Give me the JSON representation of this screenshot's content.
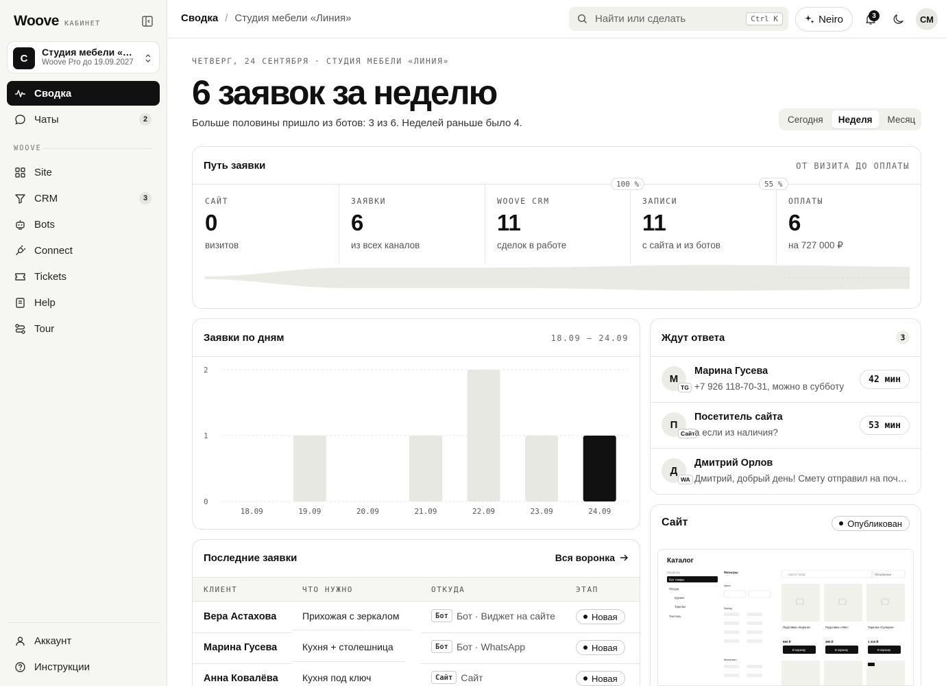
{
  "brand": {
    "name": "Woove",
    "sub": "КАБИНЕТ"
  },
  "workspace": {
    "initial": "С",
    "name": "Студия мебели «Линия»",
    "plan": "Woove Pro до 19.09.2027"
  },
  "nav": {
    "main": [
      {
        "label": "Сводка",
        "icon": "pulse-icon",
        "active": true
      },
      {
        "label": "Чаты",
        "icon": "chat-icon",
        "badge": "2"
      }
    ],
    "section": "WOOVE",
    "woove": [
      {
        "label": "Site",
        "icon": "grid-icon"
      },
      {
        "label": "CRM",
        "icon": "funnel-icon",
        "badge": "3"
      },
      {
        "label": "Bots",
        "icon": "bot-icon"
      },
      {
        "label": "Connect",
        "icon": "plug-icon"
      },
      {
        "label": "Tickets",
        "icon": "ticket-icon"
      },
      {
        "label": "Help",
        "icon": "book-icon"
      },
      {
        "label": "Tour",
        "icon": "route-icon"
      }
    ],
    "bottom": [
      {
        "label": "Аккаунт",
        "icon": "user-icon"
      },
      {
        "label": "Инструкции",
        "icon": "help-circle-icon"
      }
    ]
  },
  "topbar": {
    "crumb1": "Сводка",
    "crumb2": "Студия мебели «Линия»",
    "search_placeholder": "Найти или сделать",
    "shortcut": "Ctrl K",
    "neiro": "Neiro",
    "notifications": "3",
    "user_initials": "СМ"
  },
  "header": {
    "date_line": "ЧЕТВЕРГ, 24 СЕНТЯБРЯ · СТУДИЯ МЕБЕЛИ «ЛИНИЯ»",
    "headline": "6 заявок за неделю",
    "subline": "Больше половины пришло из ботов: 3 из 6. Неделей раньше было 4.",
    "periods": [
      "Сегодня",
      "Неделя",
      "Месяц"
    ],
    "active_period": "Неделя"
  },
  "funnel": {
    "title": "Путь заявки",
    "meta": "ОТ ВИЗИТА ДО ОПЛАТЫ",
    "stages": [
      {
        "label": "САЙТ",
        "value": "0",
        "sub": "визитов"
      },
      {
        "label": "ЗАЯВКИ",
        "value": "6",
        "sub": "из всех каналов"
      },
      {
        "label": "WOOVE CRM",
        "value": "11",
        "sub": "сделок в работе"
      },
      {
        "label": "ЗАПИСИ",
        "value": "11",
        "sub": "с сайта и из ботов"
      },
      {
        "label": "ОПЛАТЫ",
        "value": "6",
        "sub": "на 727 000 ₽"
      }
    ],
    "conversions": [
      "100 %",
      "55 %"
    ]
  },
  "daily": {
    "title": "Заявки по дням",
    "meta": "18.09 – 24.09"
  },
  "chart_data": {
    "type": "bar",
    "categories": [
      "18.09",
      "19.09",
      "20.09",
      "21.09",
      "22.09",
      "23.09",
      "24.09"
    ],
    "values": [
      0,
      1,
      0,
      1,
      2,
      1,
      1
    ],
    "highlight_index": 6,
    "ylim": [
      0,
      2
    ],
    "yticks": [
      "0",
      "1",
      "2"
    ],
    "title": "Заявки по дням",
    "xlabel": "",
    "ylabel": "",
    "grid": true,
    "bar_color": "#e8e8e2",
    "highlight_color": "#111111"
  },
  "waiting": {
    "title": "Ждут ответа",
    "count": "3",
    "items": [
      {
        "initial": "М",
        "src": "TG",
        "name": "Марина Гусева",
        "text": "+7 926 118-70-31, можно в субботу",
        "time": "42 мин"
      },
      {
        "initial": "П",
        "src": "Сайт",
        "name": "Посетитель сайта",
        "text": "а если из наличия?",
        "time": "53 мин"
      },
      {
        "initial": "Д",
        "src": "WA",
        "name": "Дмитрий Орлов",
        "text": "Дмитрий, добрый день! Смету отправил на почту, посмотрите",
        "time": ""
      }
    ]
  },
  "recent": {
    "title": "Последние заявки",
    "link": "Вся воронка",
    "columns": [
      "КЛИЕНТ",
      "ЧТО НУЖНО",
      "ОТКУДА",
      "ЭТАП"
    ],
    "rows": [
      {
        "client": "Вера Астахова",
        "need": "Прихожая с зеркалом",
        "tag": "Бот",
        "src": "Бот · Виджет на сайте",
        "stage": "Новая"
      },
      {
        "client": "Марина Гусева",
        "need": "Кухня + столешница",
        "tag": "Бот",
        "src": "Бот · WhatsApp",
        "stage": "Новая"
      },
      {
        "client": "Анна Ковалёва",
        "need": "Кухня под ключ",
        "tag": "Сайт",
        "src": "Сайт",
        "stage": "Новая"
      }
    ]
  },
  "site": {
    "title": "Сайт",
    "status": "Опубликован",
    "preview": {
      "heading": "Каталог",
      "sections_label": "РАЗДЕЛЫ",
      "sections": [
        "Все товары",
        "Посуда",
        "Кружки",
        "Тарелки",
        "Текстиль"
      ],
      "filters_label": "Фильтры",
      "price_label": "Цена",
      "brand_label": "Бренд",
      "material_label": "Материал",
      "search": "Найти товар",
      "sort": "Популярные",
      "products": [
        {
          "name": "Подставка «Корона»",
          "price": "650 ₽",
          "btn": "В корзину"
        },
        {
          "name": "Подставка «Лён»",
          "price": "490 ₽",
          "btn": "В корзину"
        },
        {
          "name": "Тарелка «Суперон»",
          "price": "1 310 ₽",
          "btn": "В корзину"
        }
      ]
    }
  }
}
